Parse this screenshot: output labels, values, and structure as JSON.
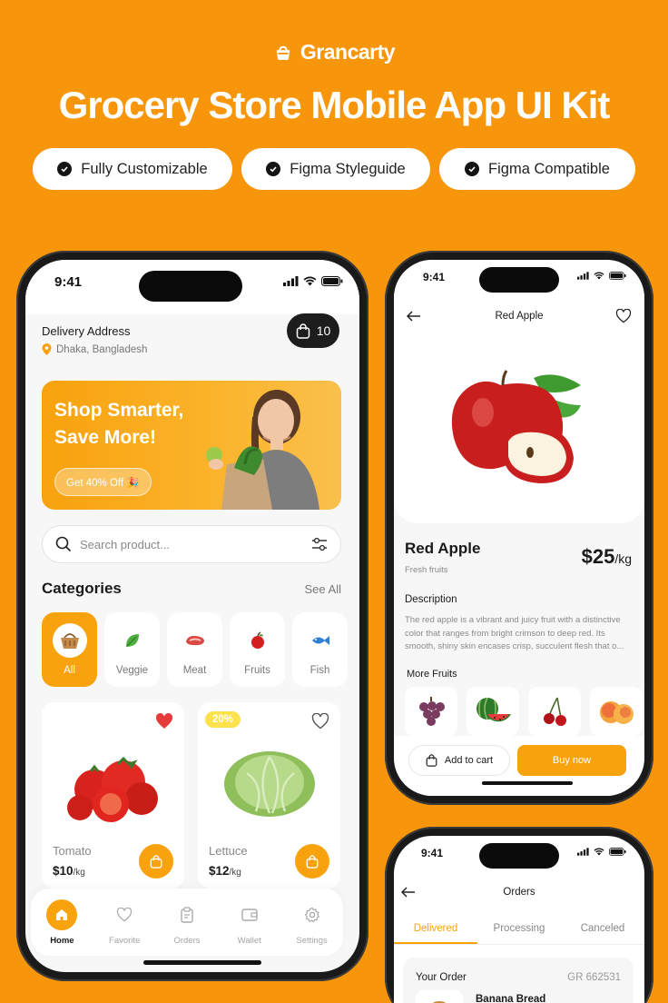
{
  "brand": {
    "name": "Grancarty"
  },
  "headline": "Grocery Store Mobile App UI Kit",
  "features": [
    "Fully Customizable",
    "Figma Styleguide",
    "Figma Compatible"
  ],
  "colors": {
    "accent": "#f8a20e",
    "background": "#f7960b",
    "dark": "#1d1d1d"
  },
  "home_screen": {
    "status_time": "9:41",
    "delivery_label": "Delivery Address",
    "delivery_location": "Dhaka, Bangladesh",
    "cart_count": "10",
    "banner": {
      "title": "Shop Smarter, Save More!",
      "cta": "Get 40% Off 🎉"
    },
    "search_placeholder": "Search product...",
    "categories_title": "Categories",
    "see_all": "See All",
    "categories": [
      {
        "label": "All",
        "icon": "basket-icon",
        "active": true
      },
      {
        "label": "Veggie",
        "icon": "leaf-icon"
      },
      {
        "label": "Meat",
        "icon": "meat-icon"
      },
      {
        "label": "Fruits",
        "icon": "apple-icon"
      },
      {
        "label": "Fish",
        "icon": "fish-icon"
      }
    ],
    "products": [
      {
        "name": "Tomato",
        "price": "$10",
        "unit": "/kg",
        "favorited": true,
        "badge": ""
      },
      {
        "name": "Lettuce",
        "price": "$12",
        "unit": "/kg",
        "favorited": false,
        "badge": "20%"
      }
    ],
    "tabs": [
      {
        "label": "Home",
        "icon": "home-icon",
        "active": true
      },
      {
        "label": "Favorite",
        "icon": "heart-icon"
      },
      {
        "label": "Orders",
        "icon": "clipboard-icon"
      },
      {
        "label": "Wallet",
        "icon": "wallet-icon"
      },
      {
        "label": "Settings",
        "icon": "gear-icon"
      }
    ]
  },
  "detail_screen": {
    "status_time": "9:41",
    "title": "Red Apple",
    "product_name": "Red Apple",
    "category": "Fresh fruits",
    "price": "$25",
    "unit": "/kg",
    "description_title": "Description",
    "description": "The red apple is a vibrant and juicy fruit with a distinctive color that ranges from bright crimson to deep red. Its smooth, shiny skin encases crisp, succulent flesh that o...",
    "more_title": "More Fruits",
    "more_fruits": [
      "grapes-icon",
      "watermelon-icon",
      "cherry-icon",
      "peach-icon"
    ],
    "add_to_cart": "Add to cart",
    "buy_now": "Buy now"
  },
  "orders_screen": {
    "status_time": "9:41",
    "title": "Orders",
    "tabs": [
      "Delivered",
      "Processing",
      "Canceled"
    ],
    "your_order": "Your Order",
    "order_id": "GR 662531",
    "item_name": "Banana Bread"
  }
}
